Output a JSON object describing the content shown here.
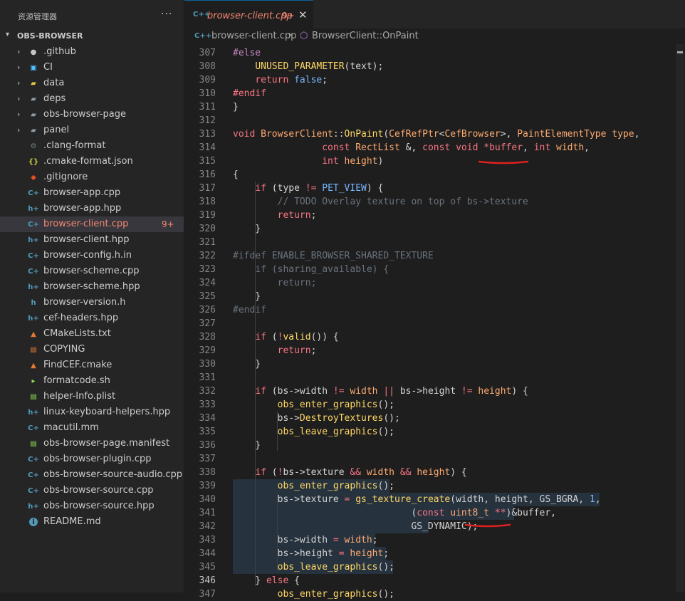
{
  "sidebar": {
    "title": "资源管理器",
    "more": "···",
    "root_folder": "OBS-BROWSER",
    "items": [
      {
        "name": ".github",
        "kind": "folder",
        "icon": "github-folder-icon"
      },
      {
        "name": "CI",
        "kind": "folder",
        "icon": "ci-folder-icon"
      },
      {
        "name": "data",
        "kind": "folder",
        "icon": "data-folder-icon"
      },
      {
        "name": "deps",
        "kind": "folder",
        "icon": "folder-icon"
      },
      {
        "name": "obs-browser-page",
        "kind": "folder",
        "icon": "folder-icon"
      },
      {
        "name": "panel",
        "kind": "folder",
        "icon": "folder-icon"
      },
      {
        "name": ".clang-format",
        "kind": "file",
        "icon": "gear-icon"
      },
      {
        "name": ".cmake-format.json",
        "kind": "file",
        "icon": "json-icon"
      },
      {
        "name": ".gitignore",
        "kind": "file",
        "icon": "git-icon"
      },
      {
        "name": "browser-app.cpp",
        "kind": "file",
        "icon": "cpp-icon"
      },
      {
        "name": "browser-app.hpp",
        "kind": "file",
        "icon": "hpp-icon"
      },
      {
        "name": "browser-client.cpp",
        "kind": "file",
        "icon": "cpp-icon",
        "badge": "9+",
        "selected": true
      },
      {
        "name": "browser-client.hpp",
        "kind": "file",
        "icon": "hpp-icon"
      },
      {
        "name": "browser-config.h.in",
        "kind": "file",
        "icon": "cpp-icon"
      },
      {
        "name": "browser-scheme.cpp",
        "kind": "file",
        "icon": "cpp-icon"
      },
      {
        "name": "browser-scheme.hpp",
        "kind": "file",
        "icon": "hpp-icon"
      },
      {
        "name": "browser-version.h",
        "kind": "file",
        "icon": "h-icon"
      },
      {
        "name": "cef-headers.hpp",
        "kind": "file",
        "icon": "hpp-icon"
      },
      {
        "name": "CMakeLists.txt",
        "kind": "file",
        "icon": "cmake-icon"
      },
      {
        "name": "COPYING",
        "kind": "file",
        "icon": "license-icon"
      },
      {
        "name": "FindCEF.cmake",
        "kind": "file",
        "icon": "cmake-icon"
      },
      {
        "name": "formatcode.sh",
        "kind": "file",
        "icon": "terminal-icon"
      },
      {
        "name": "helper-Info.plist",
        "kind": "file",
        "icon": "plist-icon"
      },
      {
        "name": "linux-keyboard-helpers.hpp",
        "kind": "file",
        "icon": "hpp-icon"
      },
      {
        "name": "macutil.mm",
        "kind": "file",
        "icon": "cpp-icon"
      },
      {
        "name": "obs-browser-page.manifest",
        "kind": "file",
        "icon": "manifest-icon"
      },
      {
        "name": "obs-browser-plugin.cpp",
        "kind": "file",
        "icon": "cpp-icon"
      },
      {
        "name": "obs-browser-source-audio.cpp",
        "kind": "file",
        "icon": "cpp-icon"
      },
      {
        "name": "obs-browser-source.cpp",
        "kind": "file",
        "icon": "cpp-icon"
      },
      {
        "name": "obs-browser-source.hpp",
        "kind": "file",
        "icon": "hpp-icon"
      },
      {
        "name": "README.md",
        "kind": "file",
        "icon": "info-icon"
      }
    ]
  },
  "tab": {
    "filename": "browser-client.cpp",
    "badge": "9+",
    "close": "✕",
    "icon_text": "C++"
  },
  "breadcrumb": {
    "file": "browser-client.cpp",
    "separator": "›",
    "symbol": "BrowserClient::OnPaint"
  },
  "code": {
    "current_line": 346,
    "lines": [
      {
        "n": 307,
        "html": "<span class='p'>#else</span>"
      },
      {
        "n": 308,
        "html": "    <span class='f'>UNUSED_PARAMETER</span>(text);"
      },
      {
        "n": 309,
        "html": "    <span class='k'>return</span> <span class='v'>false</span>;"
      },
      {
        "n": 310,
        "html": "<span class='k'>#endif</span>"
      },
      {
        "n": 311,
        "html": "}"
      },
      {
        "n": 312,
        "html": ""
      },
      {
        "n": 313,
        "html": "<span class='k'>void</span> <span class='t'>BrowserClient</span>::<span class='f'>OnPaint</span>(<span class='t'>CefRefPtr</span>&lt;<span class='t'>CefBrowser</span>&gt;, <span class='t'>PaintElementType</span> <span class='t'>type</span>,"
      },
      {
        "n": 314,
        "html": "                <span class='k'>const</span> <span class='t'>RectList</span> &amp;, <span class='k'>const</span> <span class='k'>void</span> <span class='k'>*buffer</span>, <span class='k'>int</span> <span class='t'>width</span>,"
      },
      {
        "n": 315,
        "html": "                <span class='k'>int</span> <span class='t'>height</span>)"
      },
      {
        "n": 316,
        "html": "{"
      },
      {
        "n": 317,
        "html": "    <span class='k'>if</span> (type <span class='k'>!=</span> <span class='v'>PET_VIEW</span>) {"
      },
      {
        "n": 318,
        "html": "        <span class='c'>// TODO Overlay texture on top of bs-&gt;texture</span>"
      },
      {
        "n": 319,
        "html": "        <span class='k'>return</span>;"
      },
      {
        "n": 320,
        "html": "    }"
      },
      {
        "n": 321,
        "html": ""
      },
      {
        "n": 322,
        "html": "<span class='c'>#ifdef ENABLE_BROWSER_SHARED_TEXTURE</span>"
      },
      {
        "n": 323,
        "html": "    <span class='c'>if (sharing_available) {</span>"
      },
      {
        "n": 324,
        "html": "        <span class='c'>return;</span>"
      },
      {
        "n": 325,
        "html": "    }"
      },
      {
        "n": 326,
        "html": "<span class='c'>#endif</span>"
      },
      {
        "n": 327,
        "html": ""
      },
      {
        "n": 328,
        "html": "    <span class='k'>if</span> (<span class='k'>!</span><span class='f'>valid</span>()) {"
      },
      {
        "n": 329,
        "html": "        <span class='k'>return</span>;"
      },
      {
        "n": 330,
        "html": "    }"
      },
      {
        "n": 331,
        "html": ""
      },
      {
        "n": 332,
        "html": "    <span class='k'>if</span> (bs-&gt;width <span class='k'>!=</span> <span class='t'>width</span> <span class='k'>||</span> bs-&gt;height <span class='k'>!=</span> <span class='t'>height</span>) {"
      },
      {
        "n": 333,
        "html": "        <span class='f'>obs_enter_graphics</span>();"
      },
      {
        "n": 334,
        "html": "        bs-&gt;<span class='f'>DestroyTextures</span>();"
      },
      {
        "n": 335,
        "html": "        <span class='f'>obs_leave_graphics</span>();"
      },
      {
        "n": 336,
        "html": "    }"
      },
      {
        "n": 337,
        "html": ""
      },
      {
        "n": 338,
        "html": "    <span class='k'>if</span> (<span class='k'>!</span>bs-&gt;texture <span class='k'>&amp;&amp;</span> <span class='t'>width</span> <span class='k'>&amp;&amp;</span> <span class='t'>height</span>) {"
      },
      {
        "n": 339,
        "html": "        <span class='f'>obs_enter_graphics</span>();"
      },
      {
        "n": 340,
        "html": "        bs-&gt;texture <span class='k'>=</span> <span class='f'>gs_texture_create</span>(width, height, GS_BGRA, <span class='v'>1</span>,"
      },
      {
        "n": 341,
        "html": "                                (<span class='k'>const</span> <span class='t'>uint8_t</span> <span class='k'>**</span>)&amp;buffer,"
      },
      {
        "n": 342,
        "html": "                                GS_DYNAMIC);"
      },
      {
        "n": 343,
        "html": "        bs-&gt;width <span class='k'>=</span> <span class='t'>width</span>;"
      },
      {
        "n": 344,
        "html": "        bs-&gt;height <span class='k'>=</span> <span class='t'>height</span>;"
      },
      {
        "n": 345,
        "html": "        <span class='f'>obs_leave_graphics</span>();"
      },
      {
        "n": 346,
        "html": "    } <span class='k'>else</span> {"
      },
      {
        "n": 347,
        "html": "        <span class='f'>obs_enter_graphics</span>();"
      }
    ]
  },
  "colors": {
    "accent": "#0e639c",
    "error": "#f48771",
    "annotation": "#e02020"
  }
}
